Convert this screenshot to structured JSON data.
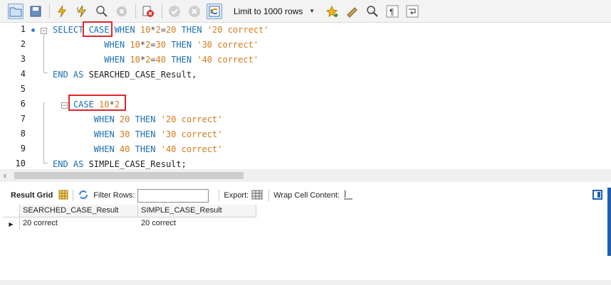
{
  "toolbar": {
    "limit_label": "Limit to 1000 rows",
    "icons": [
      "open-folder-icon",
      "save-icon",
      "execute-icon",
      "execute-current-icon",
      "explain-icon",
      "stop-icon",
      "toggle-error-icon",
      "commit-icon",
      "rollback-icon",
      "autocommit-icon",
      "beautify-icon",
      "eraser-icon",
      "search-icon",
      "invisible-chars-icon",
      "wrap-icon"
    ]
  },
  "editor": {
    "line_numbers": [
      "1",
      "2",
      "3",
      "4",
      "5",
      "6",
      "7",
      "8",
      "9",
      "10"
    ],
    "lines": [
      [
        {
          "t": "kw",
          "v": "SELECT "
        },
        {
          "t": "kw",
          "v": "CASE"
        },
        {
          "t": "kw",
          "v": " WHEN "
        },
        {
          "t": "num",
          "v": "10"
        },
        {
          "t": "op",
          "v": "*"
        },
        {
          "t": "num",
          "v": "2"
        },
        {
          "t": "op",
          "v": "="
        },
        {
          "t": "num",
          "v": "20"
        },
        {
          "t": "kw",
          "v": " THEN "
        },
        {
          "t": "str",
          "v": "'20 correct'"
        }
      ],
      [
        {
          "t": "kw",
          "v": "          WHEN "
        },
        {
          "t": "num",
          "v": "10"
        },
        {
          "t": "op",
          "v": "*"
        },
        {
          "t": "num",
          "v": "2"
        },
        {
          "t": "op",
          "v": "="
        },
        {
          "t": "num",
          "v": "30"
        },
        {
          "t": "kw",
          "v": " THEN "
        },
        {
          "t": "str",
          "v": "'30 correct'"
        }
      ],
      [
        {
          "t": "kw",
          "v": "          WHEN "
        },
        {
          "t": "num",
          "v": "10"
        },
        {
          "t": "op",
          "v": "*"
        },
        {
          "t": "num",
          "v": "2"
        },
        {
          "t": "op",
          "v": "="
        },
        {
          "t": "num",
          "v": "40"
        },
        {
          "t": "kw",
          "v": " THEN "
        },
        {
          "t": "str",
          "v": "'40 correct'"
        }
      ],
      [
        {
          "t": "kw",
          "v": "END AS "
        },
        {
          "t": "txt",
          "v": "SEARCHED_CASE_Result,"
        }
      ],
      [],
      [
        {
          "t": "kw",
          "v": "    CASE "
        },
        {
          "t": "num",
          "v": "10"
        },
        {
          "t": "op",
          "v": "*"
        },
        {
          "t": "num",
          "v": "2"
        }
      ],
      [
        {
          "t": "kw",
          "v": "        WHEN "
        },
        {
          "t": "num",
          "v": "20"
        },
        {
          "t": "kw",
          "v": " THEN "
        },
        {
          "t": "str",
          "v": "'20 correct'"
        }
      ],
      [
        {
          "t": "kw",
          "v": "        WHEN "
        },
        {
          "t": "num",
          "v": "30"
        },
        {
          "t": "kw",
          "v": " THEN "
        },
        {
          "t": "str",
          "v": "'30 correct'"
        }
      ],
      [
        {
          "t": "kw",
          "v": "        WHEN "
        },
        {
          "t": "num",
          "v": "40"
        },
        {
          "t": "kw",
          "v": " THEN "
        },
        {
          "t": "str",
          "v": "'40 correct'"
        }
      ],
      [
        {
          "t": "kw",
          "v": "END AS "
        },
        {
          "t": "txt",
          "v": "SIMPLE_CASE_Result;"
        }
      ]
    ]
  },
  "result_toolbar": {
    "title": "Result Grid",
    "filter_label": "Filter Rows:",
    "export_label": "Export:",
    "wrap_label": "Wrap Cell Content:"
  },
  "grid": {
    "columns": [
      "SEARCHED_CASE_Result",
      "SIMPLE_CASE_Result"
    ],
    "rows": [
      [
        "20 correct",
        "20 correct"
      ]
    ]
  },
  "colors": {
    "keyword": "#1a6fb4",
    "number": "#d47a19",
    "highlight": "#e0242a"
  }
}
